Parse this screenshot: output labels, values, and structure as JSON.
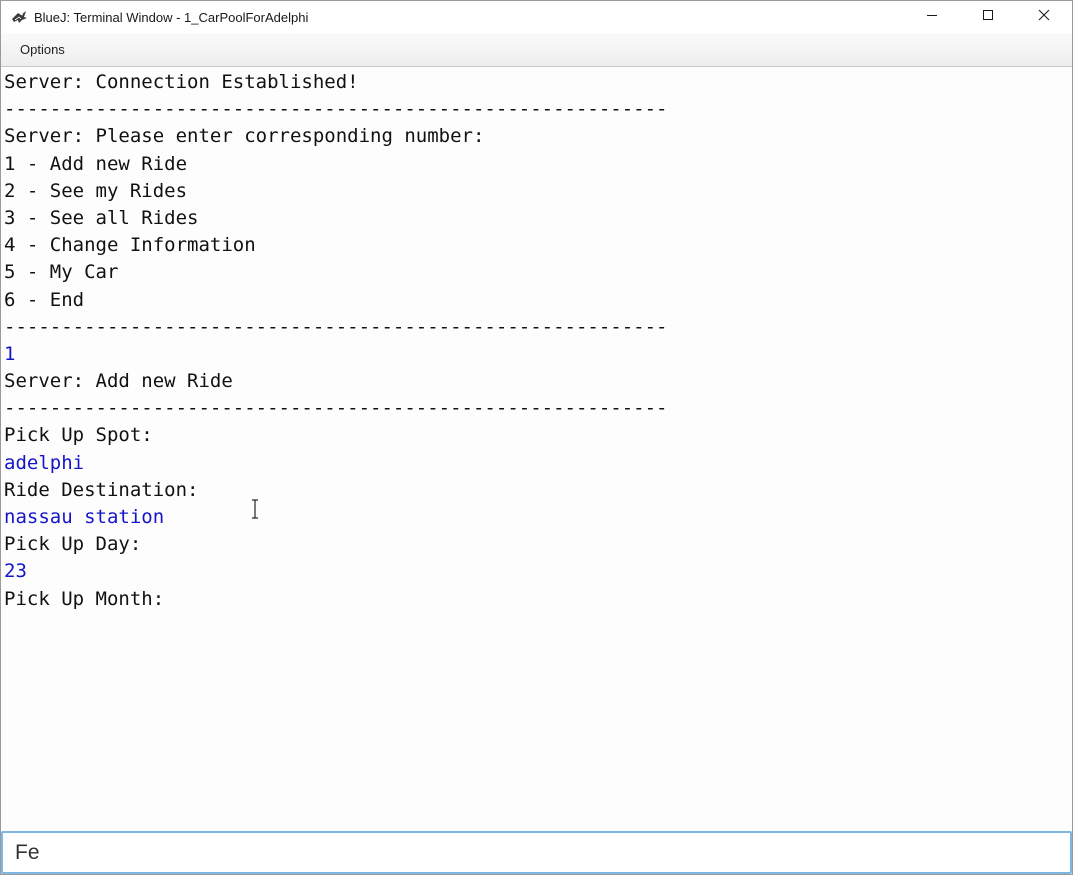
{
  "window": {
    "title": "BlueJ: Terminal Window - 1_CarPoolForAdelphi",
    "app_icon": "bluej-bird-icon",
    "controls": [
      "minimize-icon",
      "maximize-icon",
      "close-icon"
    ]
  },
  "menu": {
    "items": [
      {
        "label": "Options"
      }
    ]
  },
  "terminal": {
    "output_color": "#111111",
    "user_input_color": "#1515c8",
    "lines": [
      {
        "text": "Server: Connection Established!",
        "kind": "output"
      },
      {
        "text": "----------------------------------------------------------",
        "kind": "output"
      },
      {
        "text": "Server: Please enter corresponding number:",
        "kind": "output"
      },
      {
        "text": "1 - Add new Ride",
        "kind": "output"
      },
      {
        "text": "2 - See my Rides",
        "kind": "output"
      },
      {
        "text": "3 - See all Rides",
        "kind": "output"
      },
      {
        "text": "4 - Change Information",
        "kind": "output"
      },
      {
        "text": "5 - My Car",
        "kind": "output"
      },
      {
        "text": "6 - End",
        "kind": "output"
      },
      {
        "text": "----------------------------------------------------------",
        "kind": "output"
      },
      {
        "text": "1",
        "kind": "input"
      },
      {
        "text": "Server: Add new Ride",
        "kind": "output"
      },
      {
        "text": "----------------------------------------------------------",
        "kind": "output"
      },
      {
        "text": "Pick Up Spot:",
        "kind": "output"
      },
      {
        "text": "adelphi",
        "kind": "input"
      },
      {
        "text": "Ride Destination:",
        "kind": "output"
      },
      {
        "text": "nassau station",
        "kind": "input"
      },
      {
        "text": "Pick Up Day:",
        "kind": "output"
      },
      {
        "text": "23",
        "kind": "input"
      },
      {
        "text": "Pick Up Month:",
        "kind": "output"
      }
    ]
  },
  "input": {
    "value": "Fe",
    "focus_border_color": "#7fb7e3"
  }
}
